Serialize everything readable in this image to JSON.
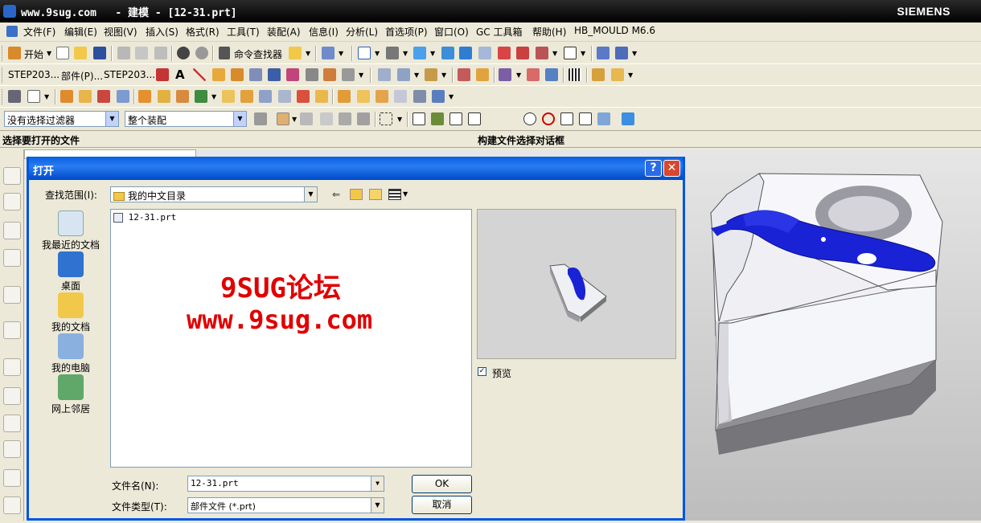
{
  "titlebar": {
    "title": "www.9sug.com   - 建模 - [12-31.prt]",
    "brand": "SIEMENS"
  },
  "menu": [
    "文件(F)",
    "编辑(E)",
    "视图(V)",
    "插入(S)",
    "格式(R)",
    "工具(T)",
    "装配(A)",
    "信息(I)",
    "分析(L)",
    "首选项(P)",
    "窗口(O)",
    "GC 工具箱",
    "帮助(H)",
    "HB_MOULD M6.6"
  ],
  "toolbar1": {
    "start": "开始",
    "command_finder": "命令查找器"
  },
  "toolbar2": {
    "items": [
      "STEP203...",
      "部件(P)...",
      "STEP203..."
    ]
  },
  "filters": {
    "selection_filter": "没有选择过滤器",
    "assembly_scope": "整个装配"
  },
  "cue": {
    "left": "选择要打开的文件",
    "right": "构建文件选择对话框"
  },
  "dialog": {
    "title": "打开",
    "help": "?",
    "close": "✕",
    "lookin_label": "查找范围(I):",
    "lookin_value": "我的中文目录",
    "places": [
      "我最近的文档",
      "桌面",
      "我的文档",
      "我的电脑",
      "网上邻居"
    ],
    "files": [
      "12-31.prt"
    ],
    "preview_label": "预览",
    "filename_label": "文件名(N):",
    "filename_value": "12-31.prt",
    "filetype_label": "文件类型(T):",
    "filetype_value": "部件文件 (*.prt)",
    "ok": "OK",
    "cancel": "取消"
  },
  "watermark": {
    "line1": "9SUG论坛",
    "line2": "www.9sug.com"
  },
  "colors": {
    "accent": "#0054e3",
    "watermark": "#e00000",
    "part_blue": "#1a22d6"
  }
}
